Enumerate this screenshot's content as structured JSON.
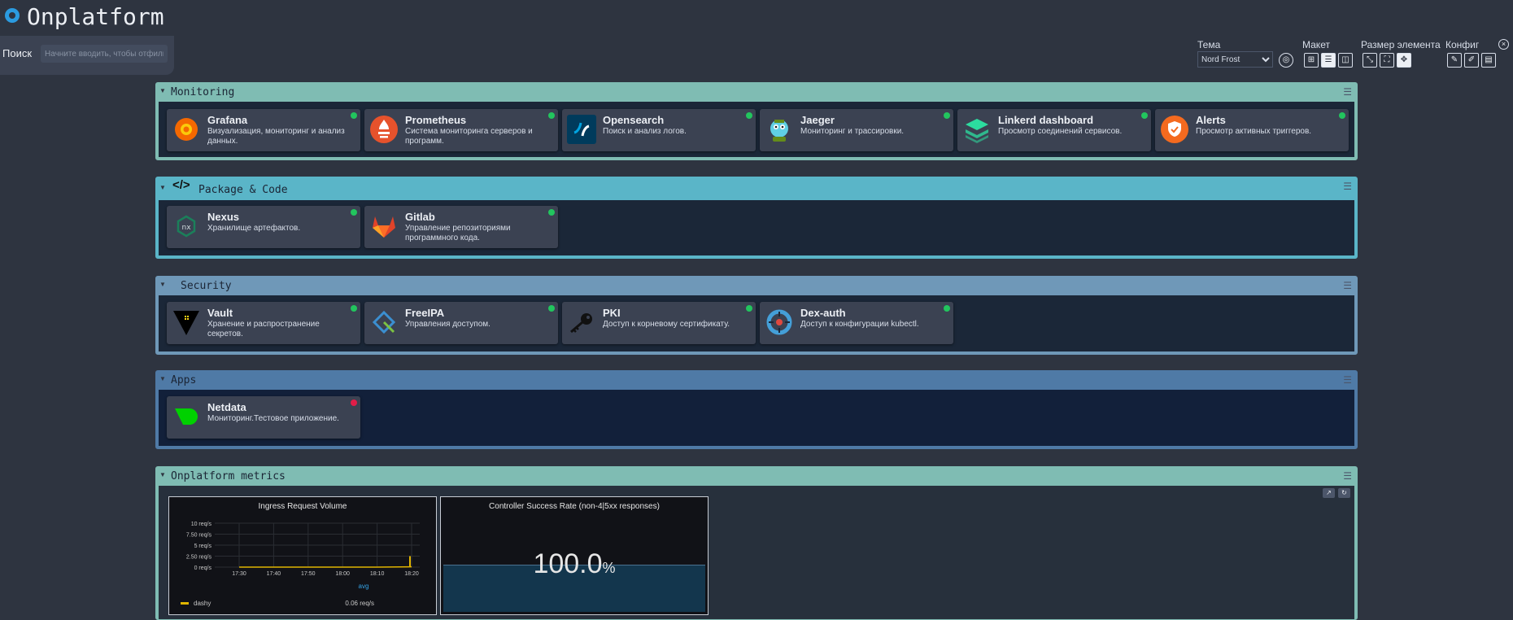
{
  "app": {
    "title": "Onplatform"
  },
  "search": {
    "label": "Поиск",
    "placeholder": "Начните вводить, чтобы отфильтровать"
  },
  "settings": {
    "theme_label": "Тема",
    "theme_value": "Nord Frost",
    "layout_label": "Макет",
    "size_label": "Размер элемента",
    "config_label": "Конфиг"
  },
  "sections": {
    "monitoring": {
      "title": "Monitoring",
      "items": [
        {
          "name": "Grafana",
          "desc": "Визуализация, мониторинг и анализ данных.",
          "status": "online"
        },
        {
          "name": "Prometheus",
          "desc": "Система мониторинга серверов и программ.",
          "status": "online"
        },
        {
          "name": "Opensearch",
          "desc": "Поиск и анализ логов.",
          "status": "online"
        },
        {
          "name": "Jaeger",
          "desc": "Мониторинг и трассировки.",
          "status": "online"
        },
        {
          "name": "Linkerd dashboard",
          "desc": "Просмотр соединений сервисов.",
          "status": "online"
        },
        {
          "name": "Alerts",
          "desc": "Просмотр активных триггеров.",
          "status": "online"
        }
      ]
    },
    "package": {
      "title": "Package & Code",
      "items": [
        {
          "name": "Nexus",
          "desc": "Хранилище артефактов.",
          "status": "online"
        },
        {
          "name": "Gitlab",
          "desc": "Управление репозиториями программного кода.",
          "status": "online"
        }
      ]
    },
    "security": {
      "title": "Security",
      "items": [
        {
          "name": "Vault",
          "desc": "Хранение и распространение секретов.",
          "status": "online"
        },
        {
          "name": "FreeIPA",
          "desc": "Управления доступом.",
          "status": "online"
        },
        {
          "name": "PKI",
          "desc": "Доступ к корневому сертификату.",
          "status": "online"
        },
        {
          "name": "Dex-auth",
          "desc": "Доступ к конфигурации kubectl.",
          "status": "online"
        }
      ]
    },
    "apps": {
      "title": "Apps",
      "items": [
        {
          "name": "Netdata",
          "desc": "Мониторинг.Тестовое приложение.",
          "status": "offline"
        }
      ]
    },
    "metrics": {
      "title": "Onplatform metrics",
      "panel1": {
        "title": "Ingress Request Volume",
        "legend_title": "avg",
        "legend_series": "dashy",
        "legend_value": "0.06 req/s"
      },
      "panel2": {
        "title": "Controller Success Rate (non-4|5xx responses)",
        "value": "100.0",
        "unit": "%"
      }
    }
  },
  "colors": {
    "monitoring": "#7fbcb3",
    "package": "#5ab5c8",
    "security": "#6f98b8",
    "apps": "#4f7aa6",
    "metrics": "#7fbcb3",
    "online": "#22c55e",
    "offline": "#e11d48"
  },
  "chart_data": {
    "type": "line",
    "title": "Ingress Request Volume",
    "x": [
      "17:30",
      "17:40",
      "17:50",
      "18:00",
      "18:10",
      "18:20"
    ],
    "ylim": [
      0,
      10
    ],
    "yticks": [
      "0 req/s",
      "2.50 req/s",
      "5 req/s",
      "7.50 req/s",
      "10 req/s"
    ],
    "series": [
      {
        "name": "dashy",
        "values": [
          0,
          0,
          0,
          0,
          0,
          0.06
        ]
      }
    ]
  }
}
